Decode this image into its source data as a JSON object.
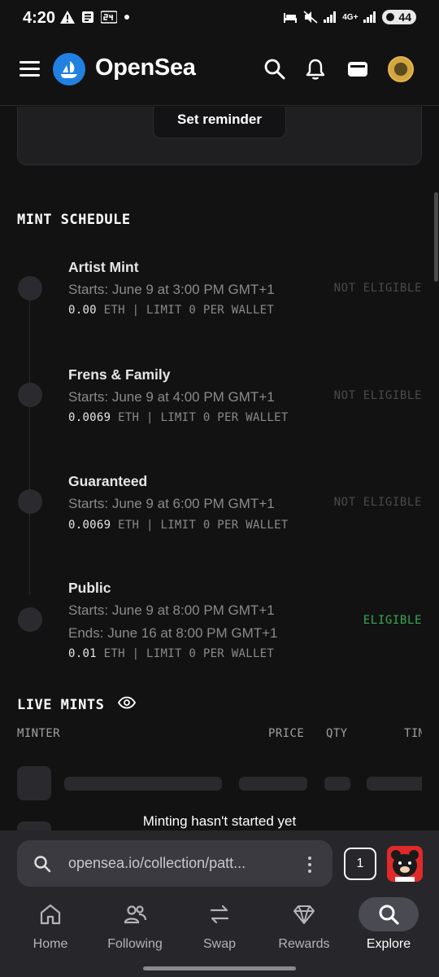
{
  "status_bar": {
    "time": "4:20",
    "notif_icons": [
      "warning-icon",
      "news-icon",
      "24-icon",
      "dot-icon"
    ],
    "network_label": "4G+",
    "battery": "44"
  },
  "header": {
    "brand": "OpenSea",
    "icons": [
      "menu-icon",
      "opensea-logo-icon",
      "search-icon",
      "bell-icon",
      "wallet-icon",
      "profile-coin-icon"
    ]
  },
  "reminder": {
    "button_label": "Set reminder"
  },
  "mint_schedule": {
    "title": "MINT SCHEDULE",
    "phases": [
      {
        "name": "Artist Mint",
        "starts": "Starts: June 9 at 3:00 PM GMT+1",
        "price": "0.00",
        "price_rest": " ETH | LIMIT 0 PER WALLET",
        "status": "NOT ELIGIBLE"
      },
      {
        "name": "Frens & Family",
        "starts": "Starts: June 9 at 4:00 PM GMT+1",
        "price": "0.0069",
        "price_rest": " ETH | LIMIT 0 PER WALLET",
        "status": "NOT ELIGIBLE"
      },
      {
        "name": "Guaranteed",
        "starts": "Starts: June 9 at 6:00 PM GMT+1",
        "price": "0.0069",
        "price_rest": " ETH | LIMIT 0 PER WALLET",
        "status": "NOT ELIGIBLE"
      },
      {
        "name": "Public",
        "starts": "Starts: June 9 at 8:00 PM GMT+1",
        "ends": "Ends: June 16 at 8:00 PM GMT+1",
        "price": "0.01",
        "price_rest": " ETH | LIMIT 0 PER WALLET",
        "status": "ELIGIBLE"
      }
    ]
  },
  "live_mints": {
    "title": "LIVE MINTS",
    "columns": [
      "MINTER",
      "PRICE",
      "QTY",
      "TIME"
    ],
    "empty_message": "Minting hasn't started yet"
  },
  "browser": {
    "url": "opensea.io/collection/patt...",
    "tab_count": "1"
  },
  "bottom_nav": {
    "items": [
      {
        "label": "Home",
        "icon": "home-icon"
      },
      {
        "label": "Following",
        "icon": "following-icon"
      },
      {
        "label": "Swap",
        "icon": "swap-icon"
      },
      {
        "label": "Rewards",
        "icon": "diamond-icon"
      },
      {
        "label": "Explore",
        "icon": "search-icon",
        "active": true
      }
    ]
  },
  "colors": {
    "background": "#121212",
    "eligible": "#3aa853",
    "not_eligible": "#4a4a4e",
    "brand_blue": "#2081e2"
  }
}
